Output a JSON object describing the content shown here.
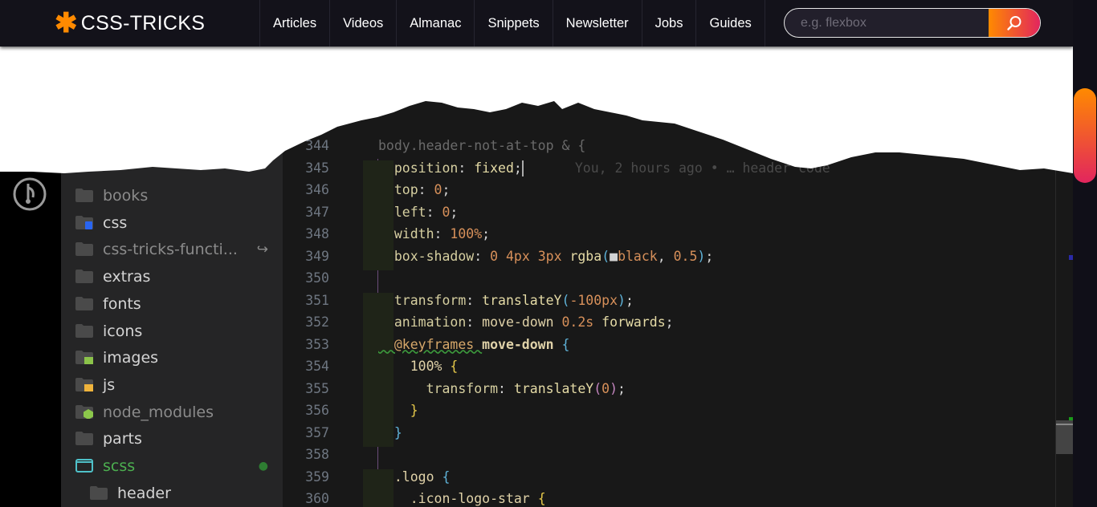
{
  "header": {
    "logo_text": "CSS-TRICKS",
    "nav": [
      "Articles",
      "Videos",
      "Almanac",
      "Snippets",
      "Newsletter",
      "Jobs",
      "Guides"
    ],
    "search_placeholder": "e.g. flexbox",
    "search_icon": "search-icon",
    "accent_gradient": [
      "#ff8a00",
      "#e2255e"
    ]
  },
  "sidebar": {
    "items": [
      {
        "label": "books",
        "icon": "folder-icon",
        "style": "dim"
      },
      {
        "label": "css",
        "icon": "folder-css-icon",
        "style": ""
      },
      {
        "label": "css-tricks-functi...",
        "icon": "folder-icon",
        "style": "dim",
        "badge": "↪"
      },
      {
        "label": "extras",
        "icon": "folder-icon",
        "style": ""
      },
      {
        "label": "fonts",
        "icon": "folder-icon",
        "style": ""
      },
      {
        "label": "icons",
        "icon": "folder-icon",
        "style": ""
      },
      {
        "label": "images",
        "icon": "folder-images-icon",
        "style": ""
      },
      {
        "label": "js",
        "icon": "folder-js-icon",
        "style": ""
      },
      {
        "label": "node_modules",
        "icon": "folder-node-icon",
        "style": "dim"
      },
      {
        "label": "parts",
        "icon": "folder-icon",
        "style": ""
      },
      {
        "label": "scss",
        "icon": "folder-open-icon",
        "style": "green",
        "badge": "●"
      },
      {
        "label": "header",
        "icon": "folder-icon",
        "style": "",
        "indent": true
      }
    ]
  },
  "palette": {
    "p": "#d6cfa0",
    "v": "#e5dba6",
    "n": "#d7905a",
    "b": "#5fb3d9",
    "y": "#e6c94a",
    "m": "#c586c0",
    "t": "#d4d4d4",
    "w": "#e0d2a8",
    "d": "#6a6a6a",
    "k": "#d7a86a"
  },
  "editor": {
    "blame": "You, 2 hours ago • … header code",
    "lines": [
      {
        "n": "344",
        "t": [
          [
            "body.header-not-at-top & ",
            "d"
          ],
          [
            "{",
            "d"
          ]
        ]
      },
      {
        "n": "345",
        "t": [
          [
            "  position",
            "p"
          ],
          [
            ": ",
            "t"
          ],
          [
            "fixed",
            "v"
          ],
          [
            ";",
            "t"
          ]
        ]
      },
      {
        "n": "346",
        "t": [
          [
            "  top",
            "p"
          ],
          [
            ": ",
            "t"
          ],
          [
            "0",
            "n"
          ],
          [
            ";",
            "t"
          ]
        ]
      },
      {
        "n": "347",
        "t": [
          [
            "  left",
            "p"
          ],
          [
            ": ",
            "t"
          ],
          [
            "0",
            "n"
          ],
          [
            ";",
            "t"
          ]
        ]
      },
      {
        "n": "348",
        "t": [
          [
            "  width",
            "p"
          ],
          [
            ": ",
            "t"
          ],
          [
            "100%",
            "n"
          ],
          [
            ";",
            "t"
          ]
        ]
      },
      {
        "n": "349",
        "t": [
          [
            "  box-shadow",
            "p"
          ],
          [
            ": ",
            "t"
          ],
          [
            "0 4px 3px ",
            "n"
          ],
          [
            "rgba",
            "v"
          ],
          [
            "(",
            "b"
          ],
          [
            "■",
            "t"
          ],
          [
            "black",
            "n"
          ],
          [
            ", ",
            "t"
          ],
          [
            "0.5",
            "n"
          ],
          [
            ")",
            "b"
          ],
          [
            ";",
            "t"
          ]
        ]
      },
      {
        "n": "350",
        "t": []
      },
      {
        "n": "351",
        "t": [
          [
            "  transform",
            "p"
          ],
          [
            ": ",
            "t"
          ],
          [
            "translateY",
            "v"
          ],
          [
            "(",
            "b"
          ],
          [
            "-100px",
            "n"
          ],
          [
            ")",
            "b"
          ],
          [
            ";",
            "t"
          ]
        ]
      },
      {
        "n": "352",
        "t": [
          [
            "  animation",
            "p"
          ],
          [
            ": ",
            "t"
          ],
          [
            "move-down ",
            "w"
          ],
          [
            "0.2s ",
            "n"
          ],
          [
            "forwards",
            "v"
          ],
          [
            ";",
            "t"
          ]
        ]
      },
      {
        "n": "353",
        "t": [
          [
            "  @keyframes ",
            "k"
          ],
          [
            "move-down ",
            "w"
          ],
          [
            "{",
            "b"
          ]
        ]
      },
      {
        "n": "354",
        "t": [
          [
            "    100% ",
            "w"
          ],
          [
            "{",
            "y"
          ]
        ]
      },
      {
        "n": "355",
        "t": [
          [
            "      transform",
            "p"
          ],
          [
            ": ",
            "t"
          ],
          [
            "translateY",
            "v"
          ],
          [
            "(",
            "m"
          ],
          [
            "0",
            "n"
          ],
          [
            ")",
            "m"
          ],
          [
            ";",
            "t"
          ]
        ]
      },
      {
        "n": "356",
        "t": [
          [
            "    }",
            "y"
          ]
        ]
      },
      {
        "n": "357",
        "t": [
          [
            "  }",
            "b"
          ]
        ]
      },
      {
        "n": "358",
        "t": []
      },
      {
        "n": "359",
        "t": [
          [
            "  .logo ",
            "w"
          ],
          [
            "{",
            "b"
          ]
        ]
      },
      {
        "n": "360",
        "t": [
          [
            "    .icon-logo-star ",
            "w"
          ],
          [
            "{",
            "y"
          ]
        ]
      }
    ]
  }
}
